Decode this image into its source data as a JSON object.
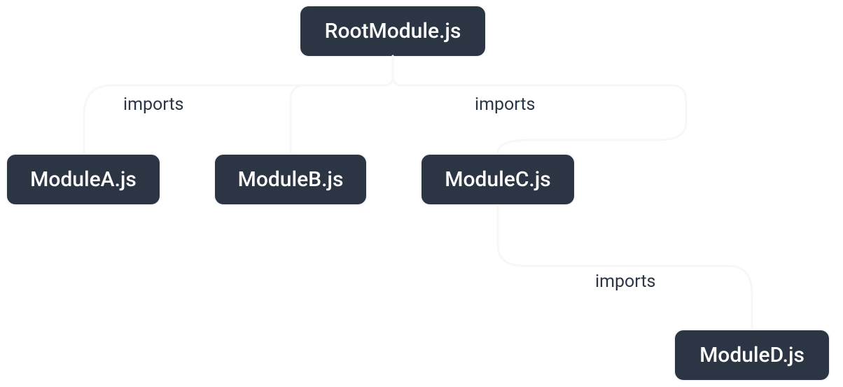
{
  "nodes": {
    "root": {
      "label": "RootModule.js"
    },
    "moduleA": {
      "label": "ModuleA.js"
    },
    "moduleB": {
      "label": "ModuleB.js"
    },
    "moduleC": {
      "label": "ModuleC.js"
    },
    "moduleD": {
      "label": "ModuleD.js"
    }
  },
  "edges": {
    "root_to_a": {
      "label": "imports"
    },
    "root_to_c": {
      "label": "imports"
    },
    "c_to_d": {
      "label": "imports"
    }
  },
  "graph": {
    "root": "RootModule.js",
    "children": [
      {
        "via": "imports",
        "node": "ModuleA.js"
      },
      {
        "via": "imports",
        "node": "ModuleB.js"
      },
      {
        "via": "imports",
        "node": "ModuleC.js",
        "children": [
          {
            "via": "imports",
            "node": "ModuleD.js"
          }
        ]
      }
    ]
  }
}
